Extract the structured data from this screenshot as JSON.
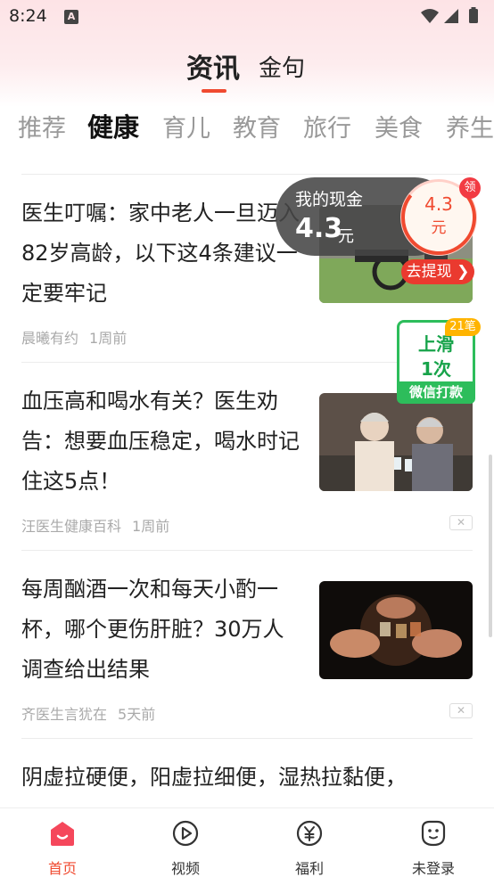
{
  "status_bar": {
    "time": "8:24",
    "notification_icon": "A"
  },
  "main_tabs": [
    {
      "label": "资讯",
      "active": true
    },
    {
      "label": "金句",
      "active": false
    }
  ],
  "categories": [
    "推荐",
    "健康",
    "育儿",
    "教育",
    "旅行",
    "美食",
    "养生"
  ],
  "active_category": "健康",
  "cash_widget": {
    "label": "我的现金",
    "value": "4.3",
    "unit": "元",
    "coin_value": "4.3",
    "coin_unit": "元",
    "badge": "领",
    "withdraw_label": "去提现"
  },
  "swipe_widget": {
    "badge": "21笔",
    "line1": "上滑",
    "line2": "1次",
    "footer": "微信打款"
  },
  "articles": [
    {
      "title": "医生叮嘱：家中老人一旦迈入82岁高龄，以下这4条建议一定要牢记",
      "source": "晨曦有约",
      "time": "1周前"
    },
    {
      "title": "血压高和喝水有关？医生劝告：想要血压稳定，喝水时记住这5点！",
      "source": "汪医生健康百科",
      "time": "1周前"
    },
    {
      "title": "每周酗酒一次和每天小酌一杯，哪个更伤肝脏？30万人调查给出结果",
      "source": "齐医生言犹在",
      "time": "5天前"
    },
    {
      "title": "阴虚拉硬便，阳虚拉细便，湿热拉黏便，"
    }
  ],
  "bottom_nav": [
    {
      "label": "首页",
      "icon": "home-icon",
      "active": true
    },
    {
      "label": "视频",
      "icon": "video-play-icon",
      "active": false
    },
    {
      "label": "福利",
      "icon": "yuan-coin-icon",
      "active": false
    },
    {
      "label": "未登录",
      "icon": "profile-face-icon",
      "active": false
    }
  ],
  "colors": {
    "accent": "#f04a30",
    "green": "#2dbd5b",
    "header_bg": "#fde3e6"
  }
}
